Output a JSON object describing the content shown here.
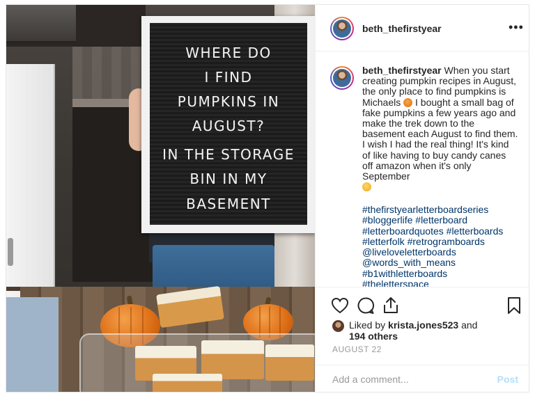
{
  "post": {
    "username": "beth_thefirstyear",
    "more_label": "•••",
    "board_lines": [
      "WHERE DO",
      "I FIND",
      "PUMPKINS IN",
      "AUGUST?",
      "IN THE STORAGE",
      "BIN IN MY",
      "BASEMENT"
    ],
    "caption": {
      "username": "beth_thefirstyear",
      "text_part1": "When you start creating pumpkin recipes in August, the only place to find pumpkins is Michaels",
      "text_part2": "I bought a small bag of fake pumpkins a few years ago and make the trek down to the basement each August to find them. I wish I had the real thing! It's kind of like having to buy candy canes off amazon when it's only September",
      "emoji1": "pumpkin-emoji",
      "emoji2": "smirk-emoji"
    },
    "hashtags": [
      "#thefirstyearletterboardseries",
      "#bloggerlife",
      "#letterboard",
      "#letterboardquotes",
      "#letterboards",
      "#letterfolk",
      "#retrogramboards",
      "@liveloveletterboards",
      "@words_with_means",
      "#b1withletterboards",
      "#theletterspace"
    ],
    "likes": {
      "prefix": "Liked by",
      "user": "krista.jones523",
      "and": "and",
      "others": "194 others"
    },
    "date": "AUGUST 22",
    "comment_placeholder": "Add a comment...",
    "post_label": "Post"
  },
  "colors": {
    "link": "#003569",
    "post_disabled": "#b2dffc",
    "muted": "#999999"
  },
  "icons": [
    "heart-icon",
    "comment-icon",
    "share-icon",
    "bookmark-icon",
    "more-icon"
  ]
}
